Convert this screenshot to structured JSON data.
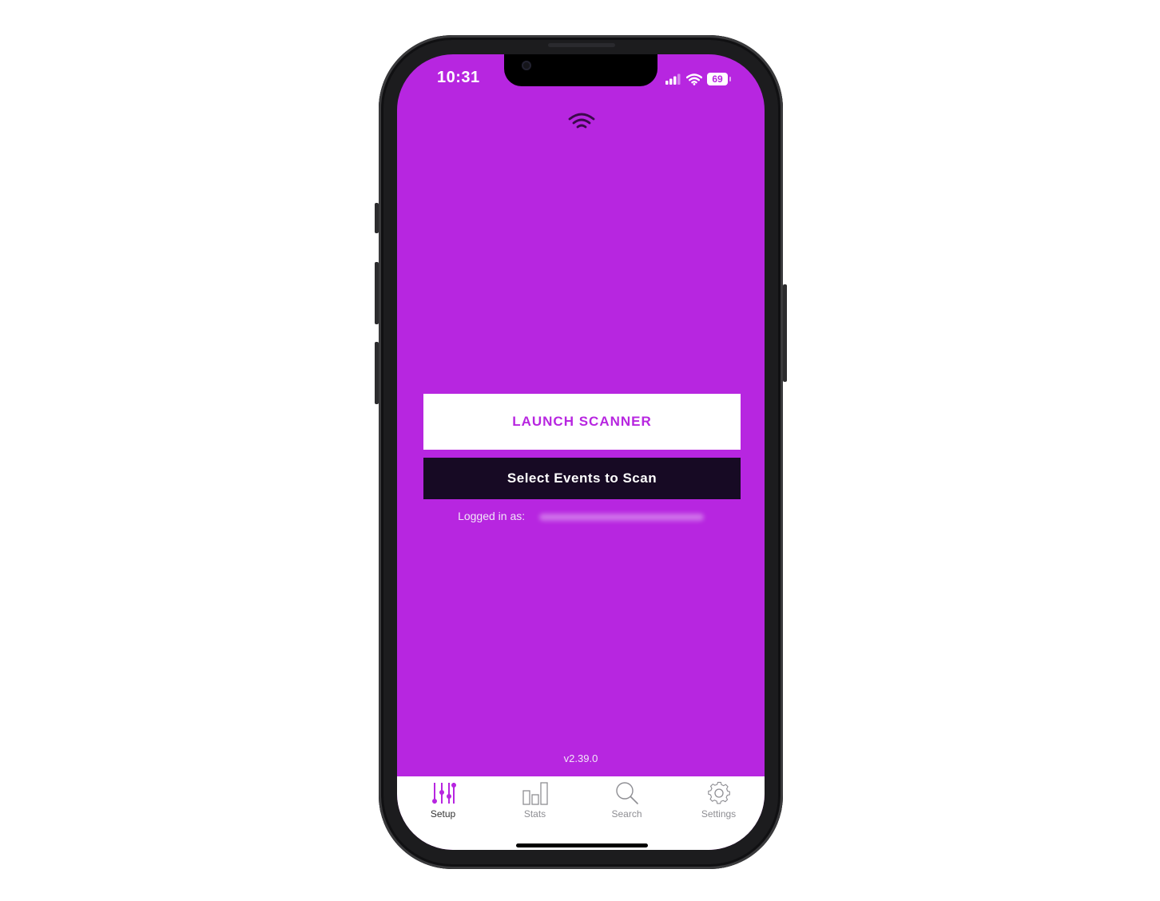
{
  "status_bar": {
    "time": "10:31",
    "battery": "69"
  },
  "main": {
    "launch_label": "LAUNCH SCANNER",
    "select_label": "Select Events to Scan",
    "logged_in_label": "Logged in as:",
    "logged_in_value": "",
    "version": "v2.39.0"
  },
  "tabs": [
    {
      "label": "Setup",
      "icon": "sliders-icon",
      "active": true
    },
    {
      "label": "Stats",
      "icon": "bar-chart-icon",
      "active": false
    },
    {
      "label": "Search",
      "icon": "magnifier-icon",
      "active": false
    },
    {
      "label": "Settings",
      "icon": "gear-icon",
      "active": false
    }
  ],
  "colors": {
    "background": "#b726e0",
    "accent": "#b726e0",
    "dark_button": "#170a24",
    "tab_bar": "#ffffff"
  }
}
